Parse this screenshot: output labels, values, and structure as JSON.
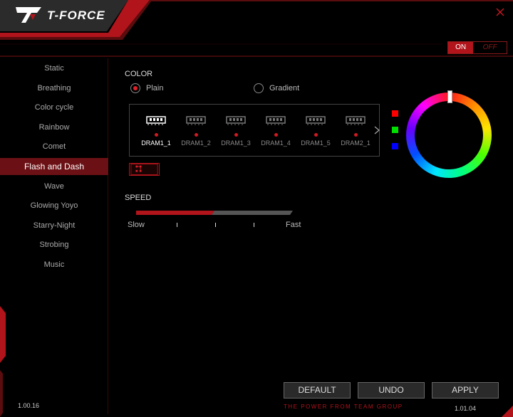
{
  "header": {
    "brand": "T-FORCE"
  },
  "power": {
    "on": "ON",
    "off": "OFF",
    "state": "on"
  },
  "sidebar": {
    "items": [
      {
        "label": "Static"
      },
      {
        "label": "Breathing"
      },
      {
        "label": "Color cycle"
      },
      {
        "label": "Rainbow"
      },
      {
        "label": "Comet"
      },
      {
        "label": "Flash and Dash",
        "active": true
      },
      {
        "label": "Wave"
      },
      {
        "label": "Glowing Yoyo"
      },
      {
        "label": "Starry-Night"
      },
      {
        "label": "Strobing"
      },
      {
        "label": "Music"
      }
    ],
    "version": "1.00.16"
  },
  "color": {
    "title": "COLOR",
    "options": [
      "Plain",
      "Gradient"
    ],
    "selected": "Plain"
  },
  "modules": [
    "DRAM1_1",
    "DRAM1_2",
    "DRAM1_3",
    "DRAM1_4",
    "DRAM1_5",
    "DRAM2_1"
  ],
  "selected_module": "DRAM1_1",
  "swatches": [
    "#ff0000",
    "#00e000",
    "#0000ff"
  ],
  "speed": {
    "title": "SPEED",
    "min_label": "Slow",
    "max_label": "Fast",
    "value": 0.5
  },
  "buttons": {
    "default": "DEFAULT",
    "undo": "UNDO",
    "apply": "APPLY"
  },
  "footer": {
    "tagline": "THE POWER FROM TEAM GROUP",
    "version": "1.01.04"
  },
  "accent": "#b1141b"
}
